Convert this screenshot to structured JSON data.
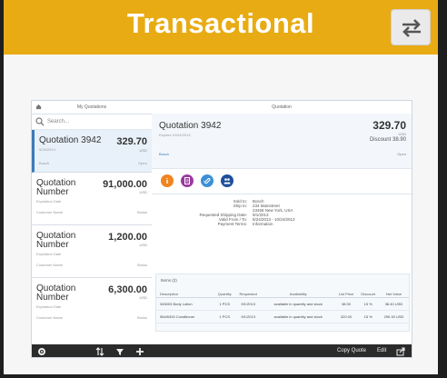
{
  "banner": {
    "title": "Transactional"
  },
  "app": {
    "master_title": "My Quotations",
    "detail_title": "Quotation",
    "search_placeholder": "Search...",
    "list": [
      {
        "name": "Quotation 3942",
        "value": "329.70",
        "currency": "USD",
        "date": "9/24/2013",
        "foot_left": "Bosch",
        "foot_right": "Open"
      },
      {
        "name": "Quotation Number",
        "value": "91,000.00",
        "currency": "USD",
        "date": "Expiration Date",
        "foot_left": "Customer Name",
        "foot_right": "Status"
      },
      {
        "name": "Quotation Number",
        "value": "1,200.00",
        "currency": "USD",
        "date": "Expiration Date",
        "foot_left": "Customer Name",
        "foot_right": "Status"
      },
      {
        "name": "Quotation Number",
        "value": "6,300.00",
        "currency": "USD",
        "date": "Expiration Date",
        "foot_left": "Customer Name",
        "foot_right": "Status"
      }
    ],
    "detail": {
      "title": "Quotation 3942",
      "subtitle": "Expires 10/24/2013",
      "amount": "329.70",
      "currency": "USD",
      "discount": "Discount 38.90",
      "customer": "Bosch",
      "status": "Open",
      "icon_colors": [
        "#f0841f",
        "#9a3b9e",
        "#3d8fd6",
        "#1f4f9a"
      ],
      "fields": [
        {
          "label": "Sold to:",
          "value": "Bosch"
        },
        {
          "label": "Ship to:",
          "value": "234 Mainstreet"
        },
        {
          "label": "",
          "value": "23456 New York, USA"
        },
        {
          "label": "Requested Shipping Date:",
          "value": "9/1/2013"
        },
        {
          "label": "Valid From / To:",
          "value": "8/24/2013 - 10/24/2013"
        },
        {
          "label": "Payment Terms:",
          "value": "Information"
        }
      ],
      "items_header": "Items (2)",
      "columns": [
        "Description",
        "Quantity",
        "Requested",
        "Availability",
        "List Price",
        "Discount",
        "Net Value"
      ],
      "rows": [
        [
          "345003 Body Lotion",
          "1 PCS",
          "9/1/2013",
          "available in quantity and stock",
          "38.90",
          "15 %",
          "38.40 USD"
        ],
        [
          "584/6300 Conditioner",
          "1 PCS",
          "9/1/2013",
          "available in quantity and stock",
          "320.00",
          "15 %",
          "290.30 USD"
        ]
      ]
    },
    "footer": {
      "copy": "Copy Quote",
      "edit": "Edit"
    }
  }
}
